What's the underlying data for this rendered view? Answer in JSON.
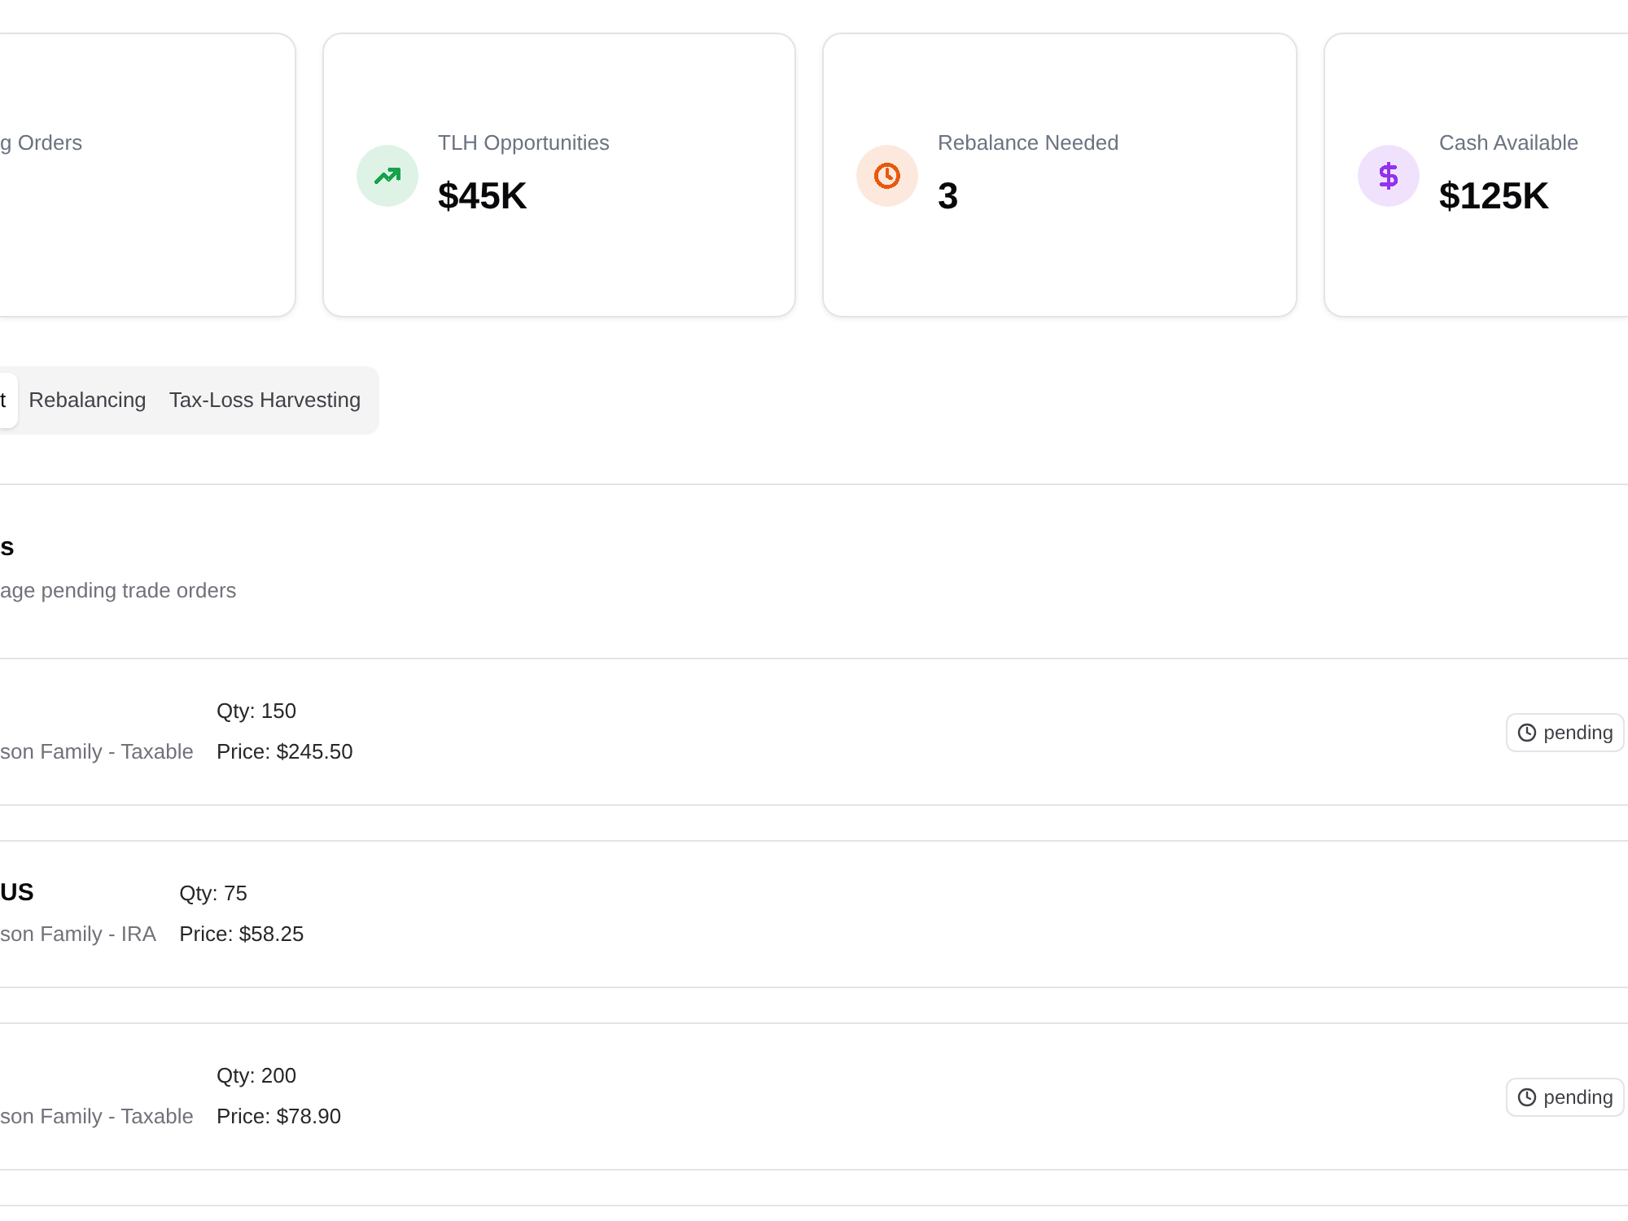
{
  "stats": [
    {
      "label": "g Orders"
    },
    {
      "label": "TLH Opportunities",
      "value": "$45K",
      "kind": "trend",
      "color": "#16a34a"
    },
    {
      "label": "Rebalance Needed",
      "value": "3",
      "kind": "clock",
      "color": "#ea580c"
    },
    {
      "label": "Cash Available",
      "value": "$125K",
      "kind": "dollar",
      "color": "#9333ea"
    }
  ],
  "tabs": [
    {
      "label": "t",
      "selected": true
    },
    {
      "label": "Rebalancing",
      "selected": false
    },
    {
      "label": "Tax-Loss Harvesting",
      "selected": false
    }
  ],
  "orders_panel": {
    "title": "s",
    "subtitle": "age pending trade orders",
    "orders": [
      {
        "account": "son Family - Taxable",
        "qty": "Qty: 150",
        "price": "Price: $245.50",
        "status": "pending"
      },
      {
        "symbol": "US",
        "account": "son Family - IRA",
        "qty": "Qty: 75",
        "price": "Price: $58.25"
      },
      {
        "account": "son Family - Taxable",
        "qty": "Qty: 200",
        "price": "Price: $78.90",
        "status": "pending"
      }
    ]
  }
}
